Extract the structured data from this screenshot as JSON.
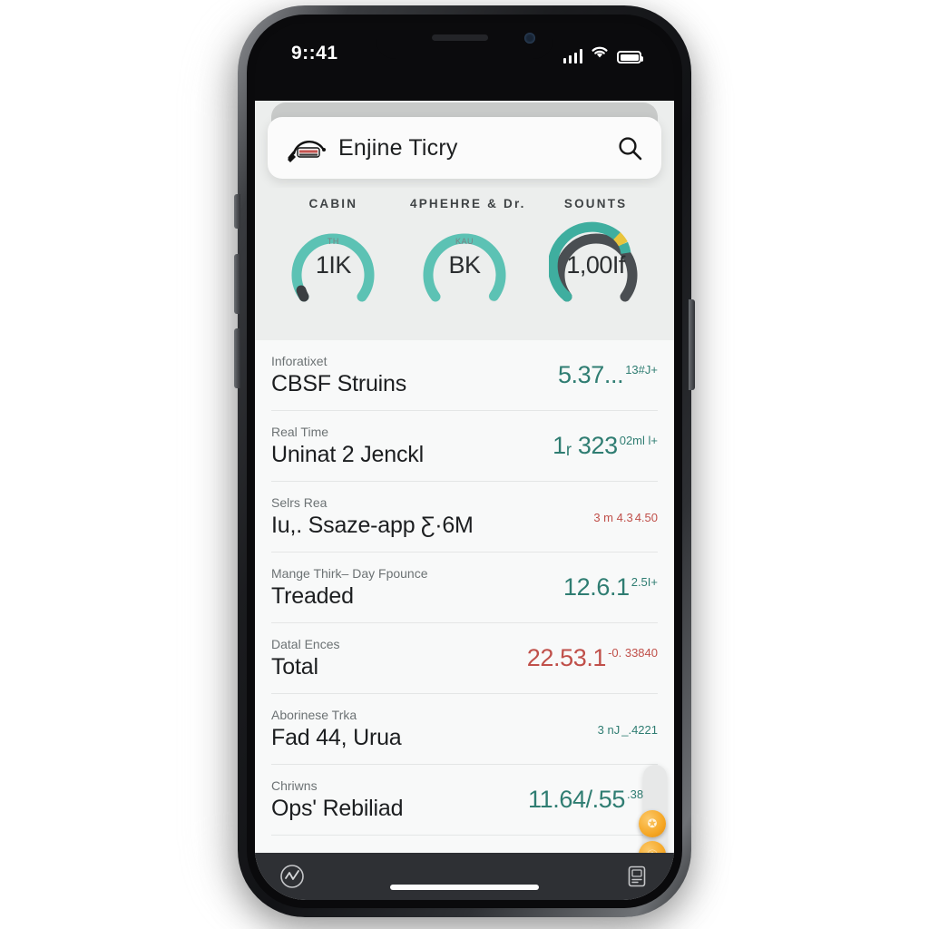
{
  "status_bar": {
    "time": "9::41",
    "signal_icon": "cellular-signal-icon",
    "wifi_icon": "wifi-icon",
    "battery_icon": "battery-full-icon"
  },
  "header": {
    "brand_icon": "car-plug-icon",
    "title": "Enjine Ticry",
    "search_icon": "search-icon"
  },
  "gauges": [
    {
      "label": "CABIN",
      "value": "1IK",
      "sub": "TH",
      "track_color": "#dfe2e1",
      "arc_color": "#5cc2b4",
      "end_color": "#3b3f42",
      "percent": 78
    },
    {
      "label": "4PHEHRE & Dr.",
      "value": "BK",
      "sub": "KAU",
      "track_color": "#dfe2e1",
      "arc_color": "#5cc2b4",
      "end_color": "#5cc2b4",
      "percent": 72
    },
    {
      "label": "SOUNTS",
      "value": "1,00If",
      "sub": "",
      "track_color": "#dfe2e1",
      "arc_color": "#3fae9f",
      "warn_color": "#e8c43c",
      "end_color": "#4a4e52",
      "percent": 62
    }
  ],
  "list_rows": [
    {
      "sub": "Inforatixet",
      "title": "CBSF Struins",
      "value": "5.37...",
      "delta": "13#J+",
      "tone": "teal"
    },
    {
      "sub": "Real Time",
      "title": "Uninat 2 Jenckl",
      "value": "1ᵣ 323",
      "delta": "02ml l+",
      "tone": "teal"
    },
    {
      "sub": "Selrs Rea",
      "title": "Iu,. Ssaze-app Ƹ·6M",
      "value": "3 m 4.3",
      "delta": "4.50",
      "tone": "red"
    },
    {
      "sub": "Mange Thirk– Day Fpounce",
      "title": "Treaded",
      "value": "12.6.1",
      "delta": "2.5I+",
      "tone": "teal"
    },
    {
      "sub": "Datal Ences",
      "title": "Total",
      "value": "22.53.1",
      "delta": "-0. 33840",
      "tone": "red"
    },
    {
      "sub": "Aborinese Trka",
      "title": "Fad 44, Urua",
      "value": "3 nJ",
      "delta": "_.4221",
      "tone": "teal"
    },
    {
      "sub": "Chriwns",
      "title": "Ops' Rebiliad",
      "value": "11.64/.55",
      "delta": ".386P",
      "tone": "teal"
    }
  ],
  "floating_buttons": [
    {
      "icon": "person-badge-icon",
      "glyph": "✪"
    },
    {
      "icon": "info-badge-icon",
      "glyph": "ⓘ"
    }
  ],
  "bottom_nav": {
    "left_icon": "activity-chart-circle-icon",
    "right_icon": "clipboard-document-icon"
  },
  "colors": {
    "accent_teal": "#5cc2b4",
    "value_teal": "#2f7d72",
    "value_red": "#c0504a",
    "fab_orange": "#f5a623",
    "app_background": "#eceeed",
    "card_background": "#f8f9f9"
  }
}
